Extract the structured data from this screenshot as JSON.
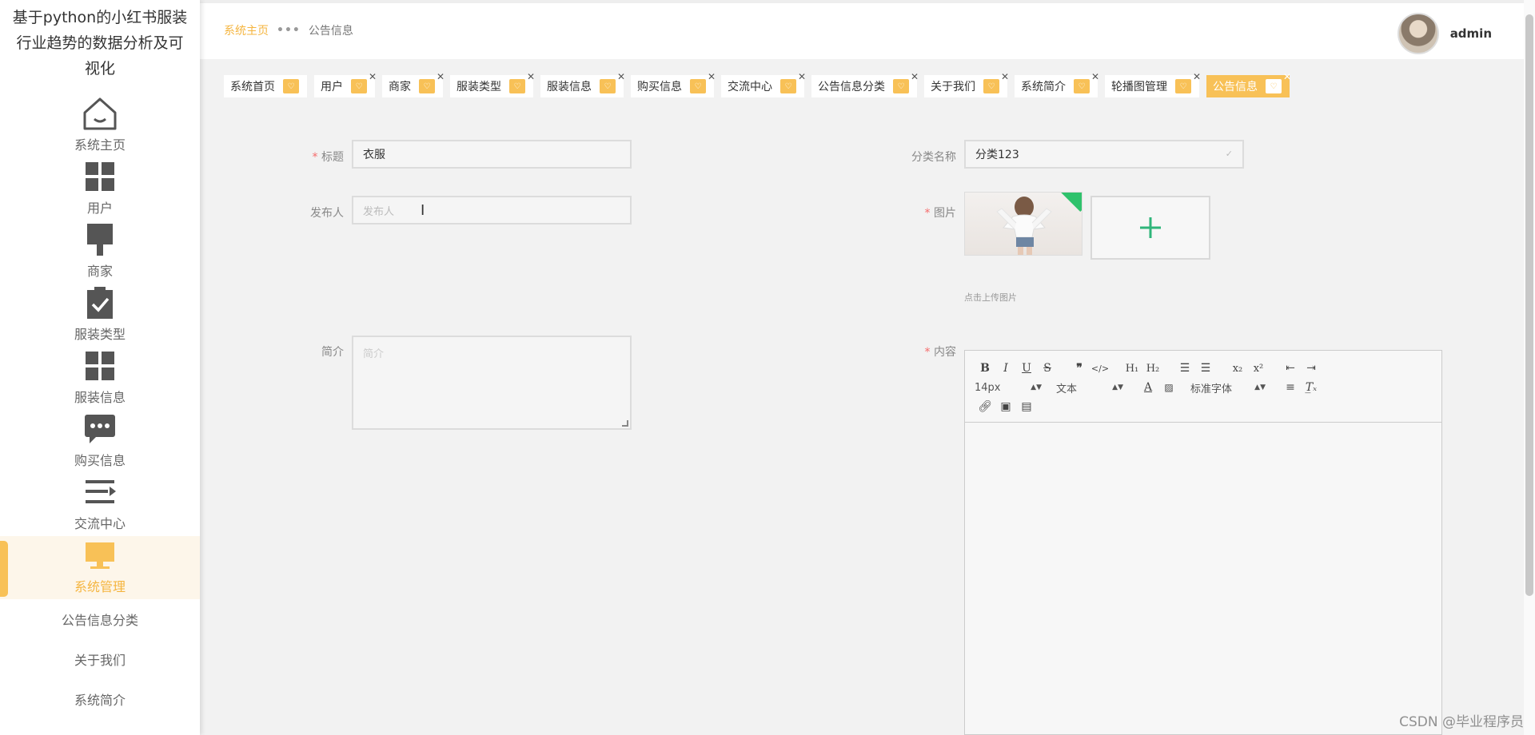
{
  "app_title": "基于python的小红书服装行业趋势的数据分析及可视化",
  "sidebar": {
    "items": [
      {
        "label": "系统主页",
        "icon": "home-icon"
      },
      {
        "label": "用户",
        "icon": "grid-icon"
      },
      {
        "label": "商家",
        "icon": "brush-icon"
      },
      {
        "label": "服装类型",
        "icon": "clipboard-check-icon"
      },
      {
        "label": "服装信息",
        "icon": "grid-icon"
      },
      {
        "label": "购买信息",
        "icon": "chat-bubble-icon"
      },
      {
        "label": "交流中心",
        "icon": "menu-list-icon"
      },
      {
        "label": "系统管理",
        "icon": "monitor-icon",
        "active": true
      }
    ],
    "sub_items": [
      "公告信息分类",
      "关于我们",
      "系统简介"
    ]
  },
  "header": {
    "breadcrumb_home": "系统主页",
    "breadcrumb_sep": "•••",
    "breadcrumb_current": "公告信息",
    "username": "admin"
  },
  "tabs": [
    {
      "label": "系统首页",
      "closable": false
    },
    {
      "label": "用户",
      "closable": true
    },
    {
      "label": "商家",
      "closable": true
    },
    {
      "label": "服装类型",
      "closable": true
    },
    {
      "label": "服装信息",
      "closable": true
    },
    {
      "label": "购买信息",
      "closable": true
    },
    {
      "label": "交流中心",
      "closable": true
    },
    {
      "label": "公告信息分类",
      "closable": true
    },
    {
      "label": "关于我们",
      "closable": true
    },
    {
      "label": "系统简介",
      "closable": true
    },
    {
      "label": "轮播图管理",
      "closable": true
    },
    {
      "label": "公告信息",
      "closable": true,
      "active": true
    }
  ],
  "form": {
    "title_label": "标题",
    "title_value": "衣服",
    "category_label": "分类名称",
    "category_value": "分类123",
    "publisher_label": "发布人",
    "publisher_placeholder": "发布人",
    "image_label": "图片",
    "upload_hint": "点击上传图片",
    "intro_label": "简介",
    "intro_placeholder": "简介",
    "content_label": "内容"
  },
  "editor": {
    "font_size": "14px",
    "block_type": "文本",
    "font_family": "标准字体"
  },
  "watermark": "CSDN @毕业程序员",
  "colors": {
    "accent": "#f8c157",
    "accent_text": "#f5b53f",
    "required": "#f56c6c",
    "upload_plus": "#2fb57a"
  }
}
